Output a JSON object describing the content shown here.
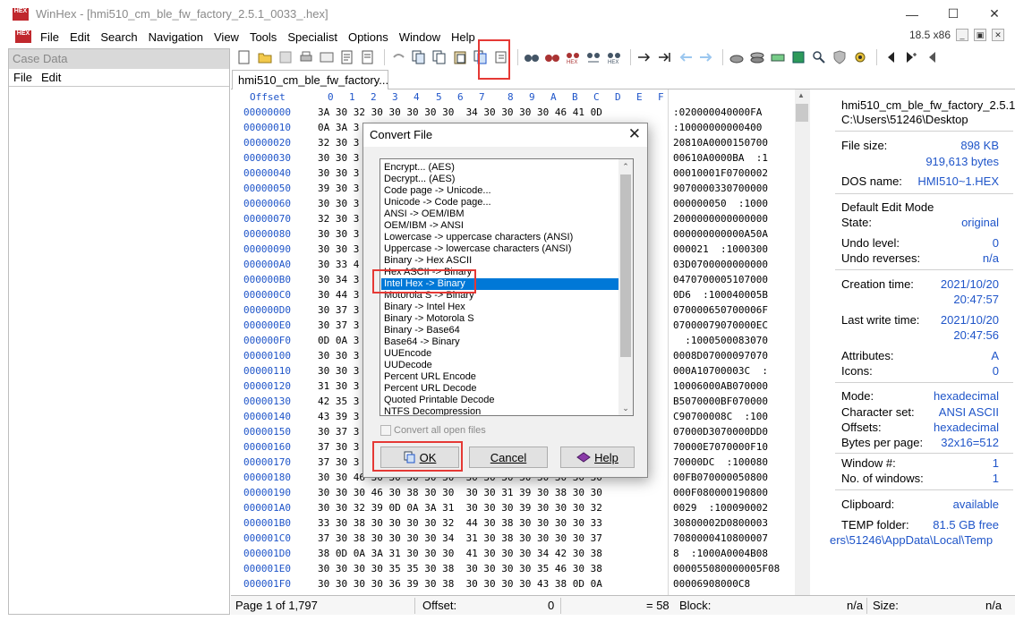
{
  "window": {
    "logo_text": "HEX",
    "title": "WinHex - [hmi510_cm_ble_fw_factory_2.5.1_0033_.hex]"
  },
  "menu": {
    "items": [
      "File",
      "Edit",
      "Search",
      "Navigation",
      "View",
      "Tools",
      "Specialist",
      "Options",
      "Window",
      "Help"
    ],
    "version": "18.5 x86"
  },
  "case_panel": {
    "title": "Case Data",
    "menu_file": "File",
    "menu_edit": "Edit"
  },
  "tab": {
    "label": "hmi510_cm_ble_fw_factory..."
  },
  "hex": {
    "offset_header": "Offset",
    "columns": [
      "0",
      "1",
      "2",
      "3",
      "4",
      "5",
      "6",
      "7",
      "8",
      "9",
      "A",
      "B",
      "C",
      "D",
      "E",
      "F"
    ],
    "rows": [
      {
        "offset": "00000000",
        "hex": "3A 30 32 30 30 30 30 30  34 30 30 30 30 46 41 0D",
        "ascii": ":020000040000FA"
      },
      {
        "offset": "00000010",
        "hex": "0A 3A 3",
        "ascii": ":10000000000400"
      },
      {
        "offset": "00000020",
        "hex": "32 30 3",
        "ascii": "20810A0000150700"
      },
      {
        "offset": "00000030",
        "hex": "30 30 3",
        "ascii": "00610A0000BA  :1"
      },
      {
        "offset": "00000040",
        "hex": "30 30 3",
        "ascii": "00010001F0700002"
      },
      {
        "offset": "00000050",
        "hex": "39 30 3",
        "ascii": "9070000330700000"
      },
      {
        "offset": "00000060",
        "hex": "30 30 3",
        "ascii": "000000050  :1000"
      },
      {
        "offset": "00000070",
        "hex": "32 30 3",
        "ascii": "2000000000000000"
      },
      {
        "offset": "00000080",
        "hex": "30 30 3",
        "ascii": "000000000000A50A"
      },
      {
        "offset": "00000090",
        "hex": "30 30 3",
        "ascii": "000021  :1000300"
      },
      {
        "offset": "000000A0",
        "hex": "30 33 4",
        "ascii": "03D0700000000000"
      },
      {
        "offset": "000000B0",
        "hex": "30 34 3",
        "ascii": "0470700005107000"
      },
      {
        "offset": "000000C0",
        "hex": "30 44 3",
        "ascii": "0D6  :100040005B"
      },
      {
        "offset": "000000D0",
        "hex": "30 37 3",
        "ascii": "070000650700006F"
      },
      {
        "offset": "000000E0",
        "hex": "30 37 3",
        "ascii": "07000079070000EC"
      },
      {
        "offset": "000000F0",
        "hex": "0D 0A 3",
        "ascii": "  :1000500083070"
      },
      {
        "offset": "00000100",
        "hex": "30 30 3",
        "ascii": "0008D07000097070"
      },
      {
        "offset": "00000110",
        "hex": "30 30 3",
        "ascii": "000A10700003C  :"
      },
      {
        "offset": "00000120",
        "hex": "31 30 3",
        "ascii": "10006000AB070000"
      },
      {
        "offset": "00000130",
        "hex": "42 35 3",
        "ascii": "B5070000BF070000"
      },
      {
        "offset": "00000140",
        "hex": "43 39 3",
        "ascii": "C90700008C  :100"
      },
      {
        "offset": "00000150",
        "hex": "30 37 3",
        "ascii": "07000D3070000DD0"
      },
      {
        "offset": "00000160",
        "hex": "37 30 3",
        "ascii": "70000E7070000F10"
      },
      {
        "offset": "00000170",
        "hex": "37 30 3",
        "ascii": "70000DC  :100080"
      },
      {
        "offset": "00000180",
        "hex": "30 30 46 30 30 30 30 30  30 30 30 30 30 30 30 30",
        "ascii": "00FB070000050800"
      },
      {
        "offset": "00000190",
        "hex": "30 30 30 46 30 38 30 30  30 30 31 39 30 38 30 30",
        "ascii": "000F080000190800"
      },
      {
        "offset": "000001A0",
        "hex": "30 30 32 39 0D 0A 3A 31  30 30 30 39 30 30 30 32",
        "ascii": "0029  :100090002"
      },
      {
        "offset": "000001B0",
        "hex": "33 30 38 30 30 30 30 32  44 30 38 30 30 30 30 33",
        "ascii": "30800002D0800003"
      },
      {
        "offset": "000001C0",
        "hex": "37 30 38 30 30 30 30 34  31 30 38 30 30 30 30 37",
        "ascii": "7080000410800007"
      },
      {
        "offset": "000001D0",
        "hex": "38 0D 0A 3A 31 30 30 30  41 30 30 30 34 42 30 38",
        "ascii": "8  :1000A0004B08"
      },
      {
        "offset": "000001E0",
        "hex": "30 30 30 30 35 35 30 38  30 30 30 30 35 46 30 38",
        "ascii": "000055080000005F08"
      },
      {
        "offset": "000001F0",
        "hex": "30 30 30 30 36 39 30 38  30 30 30 30 43 38 0D 0A",
        "ascii": "00006908000C8"
      }
    ]
  },
  "info": {
    "filename": "hmi510_cm_ble_fw_factory_2.5.1_",
    "path": "C:\\Users\\51246\\Desktop",
    "file_size_label": "File size:",
    "file_size_kb": "898 KB",
    "file_size_bytes": "919,613 bytes",
    "dos_name_label": "DOS name:",
    "dos_name": "HMI510~1.HEX",
    "edit_mode_label": "Default Edit Mode",
    "state_label": "State:",
    "state": "original",
    "undo_level_label": "Undo level:",
    "undo_level": "0",
    "undo_rev_label": "Undo reverses:",
    "undo_rev": "n/a",
    "creation_label": "Creation time:",
    "creation_date": "2021/10/20",
    "creation_time": "20:47:57",
    "lastwrite_label": "Last write time:",
    "lastwrite_date": "2021/10/20",
    "lastwrite_time": "20:47:56",
    "attributes_label": "Attributes:",
    "attributes": "A",
    "icons_label": "Icons:",
    "icons": "0",
    "mode_label": "Mode:",
    "mode": "hexadecimal",
    "charset_label": "Character set:",
    "charset": "ANSI ASCII",
    "offsets_label": "Offsets:",
    "offsets": "hexadecimal",
    "bpp_label": "Bytes per page:",
    "bpp": "32x16=512",
    "window_num_label": "Window #:",
    "window_num": "1",
    "num_windows_label": "No. of windows:",
    "num_windows": "1",
    "clipboard_label": "Clipboard:",
    "clipboard": "available",
    "temp_label": "TEMP folder:",
    "temp": "81.5 GB free",
    "temp_path": "ers\\51246\\AppData\\Local\\Temp"
  },
  "status": {
    "page": "Page 1 of 1,797",
    "offset_label": "Offset:",
    "offset": "0",
    "sel_value": "= 58",
    "block_label": "Block:",
    "block": "n/a",
    "size_label": "Size:",
    "size": "n/a"
  },
  "dialog": {
    "title": "Convert File",
    "options": [
      "Encrypt... (AES)",
      "Decrypt... (AES)",
      "Code page -> Unicode...",
      "Unicode -> Code page...",
      "ANSI -> OEM/IBM",
      "OEM/IBM -> ANSI",
      "Lowercase -> uppercase characters (ANSI)",
      "Uppercase -> lowercase characters (ANSI)",
      "Binary -> Hex ASCII",
      "Hex ASCII -> Binary",
      "Intel Hex -> Binary",
      "Motorola S -> Binary",
      "Binary -> Intel Hex",
      "Binary -> Motorola S",
      "Binary -> Base64",
      "Base64 -> Binary",
      "UUEncode",
      "UUDecode",
      "Percent URL Encode",
      "Percent URL Decode",
      "Quoted Printable Decode",
      "NTFS Decompression"
    ],
    "selected_index": 10,
    "convert_all": "Convert all open files",
    "ok": "OK",
    "cancel": "Cancel",
    "help": "Help"
  },
  "colors": {
    "accent": "#1f55c9",
    "selection": "#0078d7",
    "highlight": "#e53935"
  }
}
